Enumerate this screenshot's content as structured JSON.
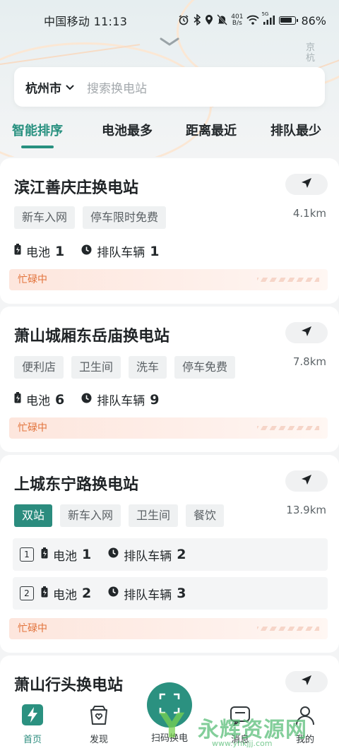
{
  "status_bar": {
    "carrier_time": "中国移动 11:13",
    "speed_value": "401",
    "speed_unit": "B/s",
    "signal_label": "5G",
    "battery_percent": "86%",
    "battery_level": 0.86
  },
  "map": {
    "label": "京杭"
  },
  "search": {
    "city": "杭州市",
    "placeholder": "搜索换电站"
  },
  "tabs": [
    {
      "label": "智能排序",
      "active": true
    },
    {
      "label": "电池最多"
    },
    {
      "label": "距离最近"
    },
    {
      "label": "排队最少"
    }
  ],
  "stations": [
    {
      "name": "滨江善庆庄换电站",
      "distance": "4.1km",
      "tags": [
        "新车入网",
        "停车限时免费"
      ],
      "battery_label": "电池",
      "battery_count": "1",
      "queue_label": "排队车辆",
      "queue_count": "1",
      "status": "忙碌中"
    },
    {
      "name": "萧山城厢东岳庙换电站",
      "distance": "7.8km",
      "tags": [
        "便利店",
        "卫生间",
        "洗车",
        "停车免费"
      ],
      "battery_label": "电池",
      "battery_count": "6",
      "queue_label": "排队车辆",
      "queue_count": "9",
      "status": "忙碌中"
    },
    {
      "name": "上城东宁路换电站",
      "distance": "13.9km",
      "highlight_tag": "双站",
      "tags": [
        "新车入网",
        "卫生间",
        "餐饮"
      ],
      "subs": [
        {
          "index": "1",
          "battery_label": "电池",
          "battery_count": "1",
          "queue_label": "排队车辆",
          "queue_count": "2"
        },
        {
          "index": "2",
          "battery_label": "电池",
          "battery_count": "2",
          "queue_label": "排队车辆",
          "queue_count": "3"
        }
      ],
      "status": "忙碌中"
    },
    {
      "name": "萧山行头换电站"
    }
  ],
  "bottom_nav": [
    {
      "label": "首页",
      "icon": "lightning-icon",
      "active": true
    },
    {
      "label": "发现",
      "icon": "bag-icon"
    },
    {
      "label": "扫码换电",
      "icon": "scan-icon"
    },
    {
      "label": "消息",
      "icon": "message-icon"
    },
    {
      "label": "我的",
      "icon": "user-icon"
    }
  ],
  "watermark": {
    "text": "永辉资源网",
    "url": "www.yhkjjj.com"
  },
  "colors": {
    "accent": "#27907f",
    "busy_text": "#e2733b",
    "busy_bg": "#fde6dd"
  }
}
